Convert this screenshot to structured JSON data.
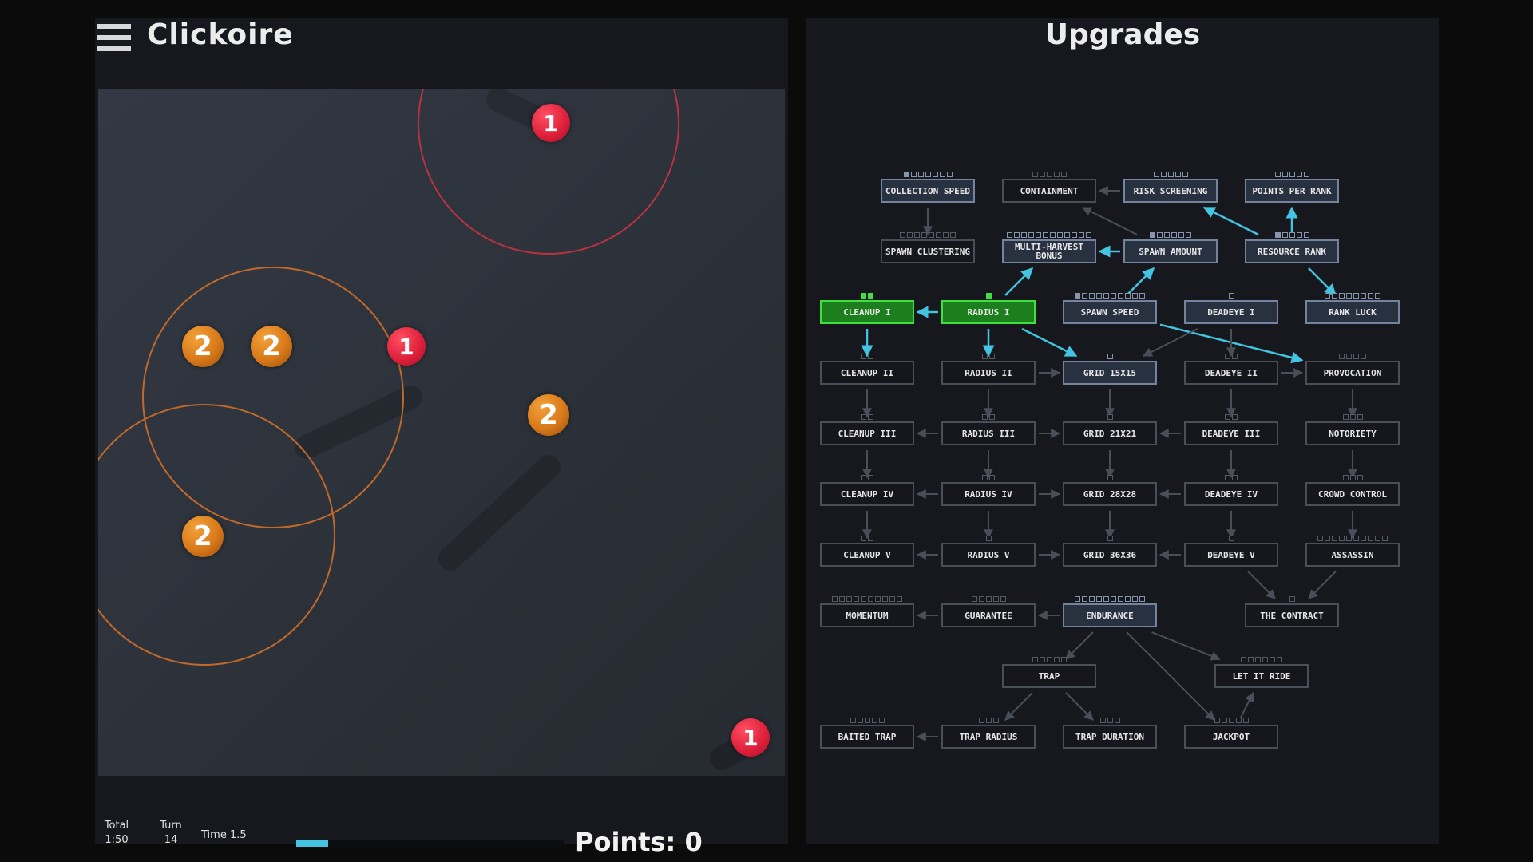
{
  "header": {
    "title": "Clickoire",
    "menu_icon": "hamburger-menu-icon"
  },
  "upgrades": {
    "title": "Upgrades"
  },
  "stats": {
    "total_label": "Total",
    "total_value": "1:50",
    "turn_label": "Turn",
    "turn_value": "14",
    "time_label": "Time 1.5",
    "time_progress": 0.12,
    "points": "Points: 0"
  },
  "colors": {
    "red_coin": "#e0213c",
    "orange_coin": "#d8791a",
    "owned": "#1c7e1c",
    "owned_border": "#3fe03f",
    "link_active": "#43c4e0",
    "progress": "#43c4e0"
  },
  "coins": [
    {
      "type": "red",
      "value": "1"
    },
    {
      "type": "orange",
      "value": "2"
    },
    {
      "type": "orange",
      "value": "2"
    },
    {
      "type": "red",
      "value": "1"
    },
    {
      "type": "orange",
      "value": "2"
    },
    {
      "type": "orange",
      "value": "2"
    },
    {
      "type": "red",
      "value": "1"
    }
  ],
  "nodes": [
    {
      "id": "collection-speed",
      "label": "COLLECTION SPEED",
      "state": "avail",
      "pips": 7,
      "filled": 1
    },
    {
      "id": "containment",
      "label": "CONTAINMENT",
      "state": "locked",
      "pips": 5,
      "filled": 0
    },
    {
      "id": "risk-screening",
      "label": "RISK SCREENING",
      "state": "avail",
      "pips": 5,
      "filled": 0
    },
    {
      "id": "points-per-rank",
      "label": "POINTS PER RANK",
      "state": "avail",
      "pips": 5,
      "filled": 0
    },
    {
      "id": "spawn-clustering",
      "label": "SPAWN CLUSTERING",
      "state": "locked",
      "pips": 8,
      "filled": 0
    },
    {
      "id": "multi-harvest-bonus",
      "label": "MULTI-HARVEST BONUS",
      "state": "avail",
      "pips": 12,
      "filled": 0
    },
    {
      "id": "spawn-amount",
      "label": "SPAWN AMOUNT",
      "state": "avail",
      "pips": 6,
      "filled": 1
    },
    {
      "id": "resource-rank",
      "label": "RESOURCE RANK",
      "state": "avail",
      "pips": 5,
      "filled": 1
    },
    {
      "id": "cleanup-1",
      "label": "CLEANUP I",
      "state": "owned",
      "pips": 2,
      "filled": 2
    },
    {
      "id": "radius-1",
      "label": "RADIUS I",
      "state": "owned",
      "pips": 1,
      "filled": 1
    },
    {
      "id": "spawn-speed",
      "label": "SPAWN SPEED",
      "state": "avail",
      "pips": 10,
      "filled": 1
    },
    {
      "id": "deadeye-1",
      "label": "DEADEYE I",
      "state": "avail",
      "pips": 1,
      "filled": 0
    },
    {
      "id": "rank-luck",
      "label": "RANK LUCK",
      "state": "avail",
      "pips": 8,
      "filled": 0
    },
    {
      "id": "cleanup-2",
      "label": "CLEANUP II",
      "state": "locked",
      "pips": 2,
      "filled": 0
    },
    {
      "id": "radius-2",
      "label": "RADIUS II",
      "state": "locked",
      "pips": 2,
      "filled": 0
    },
    {
      "id": "grid-15x15",
      "label": "GRID 15X15",
      "state": "avail",
      "pips": 1,
      "filled": 0
    },
    {
      "id": "deadeye-2",
      "label": "DEADEYE II",
      "state": "locked",
      "pips": 2,
      "filled": 0
    },
    {
      "id": "provocation",
      "label": "PROVOCATION",
      "state": "locked",
      "pips": 4,
      "filled": 0
    },
    {
      "id": "cleanup-3",
      "label": "CLEANUP III",
      "state": "locked",
      "pips": 2,
      "filled": 0
    },
    {
      "id": "radius-3",
      "label": "RADIUS III",
      "state": "locked",
      "pips": 2,
      "filled": 0
    },
    {
      "id": "grid-21x21",
      "label": "GRID 21X21",
      "state": "locked",
      "pips": 1,
      "filled": 0
    },
    {
      "id": "deadeye-3",
      "label": "DEADEYE III",
      "state": "locked",
      "pips": 2,
      "filled": 0
    },
    {
      "id": "notoriety",
      "label": "NOTORIETY",
      "state": "locked",
      "pips": 3,
      "filled": 0
    },
    {
      "id": "cleanup-4",
      "label": "CLEANUP IV",
      "state": "locked",
      "pips": 2,
      "filled": 0
    },
    {
      "id": "radius-4",
      "label": "RADIUS IV",
      "state": "locked",
      "pips": 2,
      "filled": 0
    },
    {
      "id": "grid-28x28",
      "label": "GRID 28X28",
      "state": "locked",
      "pips": 1,
      "filled": 0
    },
    {
      "id": "deadeye-4",
      "label": "DEADEYE IV",
      "state": "locked",
      "pips": 2,
      "filled": 0
    },
    {
      "id": "crowd-control",
      "label": "CROWD CONTROL",
      "state": "locked",
      "pips": 3,
      "filled": 0
    },
    {
      "id": "cleanup-5",
      "label": "CLEANUP V",
      "state": "locked",
      "pips": 2,
      "filled": 0
    },
    {
      "id": "radius-5",
      "label": "RADIUS V",
      "state": "locked",
      "pips": 1,
      "filled": 0
    },
    {
      "id": "grid-36x36",
      "label": "GRID 36X36",
      "state": "locked",
      "pips": 1,
      "filled": 0
    },
    {
      "id": "deadeye-5",
      "label": "DEADEYE V",
      "state": "locked",
      "pips": 1,
      "filled": 0
    },
    {
      "id": "assassin",
      "label": "ASSASSIN",
      "state": "locked",
      "pips": 10,
      "filled": 0
    },
    {
      "id": "momentum",
      "label": "MOMENTUM",
      "state": "locked",
      "pips": 10,
      "filled": 0
    },
    {
      "id": "guarantee",
      "label": "GUARANTEE",
      "state": "locked",
      "pips": 5,
      "filled": 0
    },
    {
      "id": "endurance",
      "label": "ENDURANCE",
      "state": "avail",
      "pips": 10,
      "filled": 0
    },
    {
      "id": "the-contract",
      "label": "THE CONTRACT",
      "state": "locked",
      "pips": 1,
      "filled": 0
    },
    {
      "id": "trap",
      "label": "TRAP",
      "state": "locked",
      "pips": 5,
      "filled": 0
    },
    {
      "id": "let-it-ride",
      "label": "LET IT RIDE",
      "state": "locked",
      "pips": 6,
      "filled": 0
    },
    {
      "id": "baited-trap",
      "label": "BAITED TRAP",
      "state": "locked",
      "pips": 5,
      "filled": 0
    },
    {
      "id": "trap-radius",
      "label": "TRAP RADIUS",
      "state": "locked",
      "pips": 3,
      "filled": 0
    },
    {
      "id": "trap-duration",
      "label": "TRAP DURATION",
      "state": "locked",
      "pips": 3,
      "filled": 0
    },
    {
      "id": "jackpot",
      "label": "JACKPOT",
      "state": "locked",
      "pips": 5,
      "filled": 0
    }
  ],
  "links": [
    [
      "collection-speed",
      "spawn-clustering",
      0
    ],
    [
      "risk-screening",
      "containment",
      0
    ],
    [
      "spawn-amount",
      "containment",
      0
    ],
    [
      "spawn-amount",
      "multi-harvest-bonus",
      1
    ],
    [
      "resource-rank",
      "risk-screening",
      1
    ],
    [
      "resource-rank",
      "points-per-rank",
      1
    ],
    [
      "resource-rank",
      "rank-luck",
      1
    ],
    [
      "radius-1",
      "cleanup-1",
      1
    ],
    [
      "radius-1",
      "multi-harvest-bonus",
      1
    ],
    [
      "spawn-speed",
      "spawn-amount",
      1
    ],
    [
      "radius-1",
      "grid-15x15",
      1
    ],
    [
      "spawn-speed",
      "provocation",
      1
    ],
    [
      "cleanup-1",
      "cleanup-2",
      1
    ],
    [
      "radius-1",
      "radius-2",
      1
    ],
    [
      "deadeye-1",
      "deadeye-2",
      0
    ],
    [
      "deadeye-1",
      "grid-15x15",
      0
    ],
    [
      "radius-2",
      "grid-15x15",
      0
    ],
    [
      "deadeye-2",
      "provocation",
      0
    ],
    [
      "cleanup-2",
      "cleanup-3",
      0
    ],
    [
      "radius-2",
      "radius-3",
      0
    ],
    [
      "grid-15x15",
      "grid-21x21",
      0
    ],
    [
      "deadeye-2",
      "deadeye-3",
      0
    ],
    [
      "radius-3",
      "cleanup-3",
      0
    ],
    [
      "radius-3",
      "grid-21x21",
      0
    ],
    [
      "deadeye-3",
      "grid-21x21",
      0
    ],
    [
      "provocation",
      "notoriety",
      0
    ],
    [
      "cleanup-3",
      "cleanup-4",
      0
    ],
    [
      "radius-3",
      "radius-4",
      0
    ],
    [
      "deadeye-3",
      "deadeye-4",
      0
    ],
    [
      "grid-21x21",
      "grid-28x28",
      0
    ],
    [
      "radius-4",
      "cleanup-4",
      0
    ],
    [
      "radius-4",
      "grid-28x28",
      0
    ],
    [
      "deadeye-4",
      "grid-28x28",
      0
    ],
    [
      "notoriety",
      "crowd-control",
      0
    ],
    [
      "cleanup-4",
      "cleanup-5",
      0
    ],
    [
      "radius-4",
      "radius-5",
      0
    ],
    [
      "deadeye-4",
      "deadeye-5",
      0
    ],
    [
      "grid-28x28",
      "grid-36x36",
      0
    ],
    [
      "radius-5",
      "cleanup-5",
      0
    ],
    [
      "radius-5",
      "grid-36x36",
      0
    ],
    [
      "deadeye-5",
      "grid-36x36",
      0
    ],
    [
      "crowd-control",
      "assassin",
      0
    ],
    [
      "deadeye-5",
      "the-contract",
      0
    ],
    [
      "assassin",
      "the-contract",
      0
    ],
    [
      "guarantee",
      "momentum",
      0
    ],
    [
      "endurance",
      "guarantee",
      0
    ],
    [
      "endurance",
      "trap",
      0
    ],
    [
      "endurance",
      "let-it-ride",
      0
    ],
    [
      "endurance",
      "jackpot",
      0
    ],
    [
      "trap",
      "trap-radius",
      0
    ],
    [
      "trap",
      "trap-duration",
      0
    ],
    [
      "jackpot",
      "let-it-ride",
      0
    ],
    [
      "trap-radius",
      "baited-trap",
      0
    ]
  ]
}
